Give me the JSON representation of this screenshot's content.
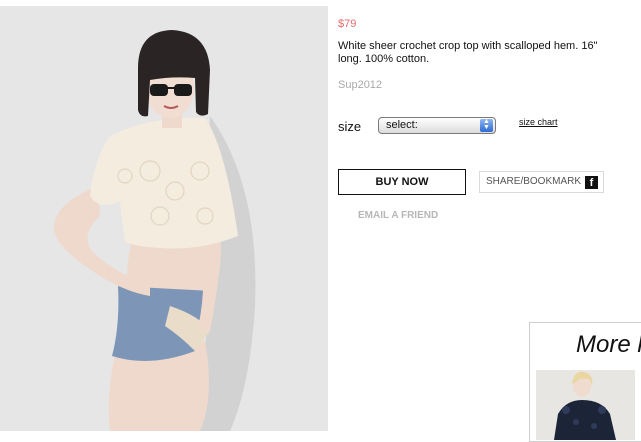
{
  "product": {
    "price": "$79",
    "description": "White sheer crochet crop top with scalloped hem. 16\" long. 100% cotton.",
    "sku": "Sup2012"
  },
  "size": {
    "label": "size",
    "select_value": "select:",
    "size_chart_link": "size chart"
  },
  "actions": {
    "buy_now": "BUY NOW",
    "share_bookmark": "SHARE/BOOKMARK",
    "facebook_icon_glyph": "f",
    "email_friend": "EMAIL A FRIEND"
  },
  "more": {
    "title": "More l"
  },
  "colors": {
    "price": "#e46a6a",
    "muted_text": "#a9a9a9",
    "select_arrow": "#2f6ad3"
  }
}
